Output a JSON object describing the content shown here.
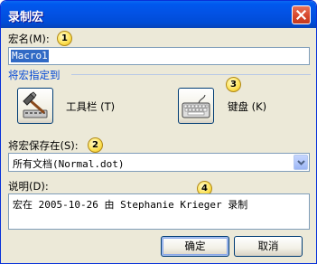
{
  "window": {
    "title": "录制宏"
  },
  "macro_name": {
    "label": "宏名(M):",
    "value": "Macro1"
  },
  "assign": {
    "heading": "将宏指定到",
    "toolbar_label": "工具栏 (T)",
    "keyboard_label": "键盘 (K)"
  },
  "store_in": {
    "label": "将宏保存在(S):",
    "value": "所有文档(Normal.dot)"
  },
  "description": {
    "label": "说明(D):",
    "value": "宏在 2005-10-26 由 Stephanie Krieger 录制"
  },
  "buttons": {
    "ok": "确定",
    "cancel": "取消"
  },
  "callouts": [
    "1",
    "2",
    "3",
    "4"
  ],
  "colors": {
    "titlebar": "#0054e3",
    "dialog_bg": "#ece9d8",
    "accent_text": "#0046d5",
    "selection": "#316ac5",
    "close_button": "#d5452a",
    "callout_fill": "#fde35a"
  }
}
